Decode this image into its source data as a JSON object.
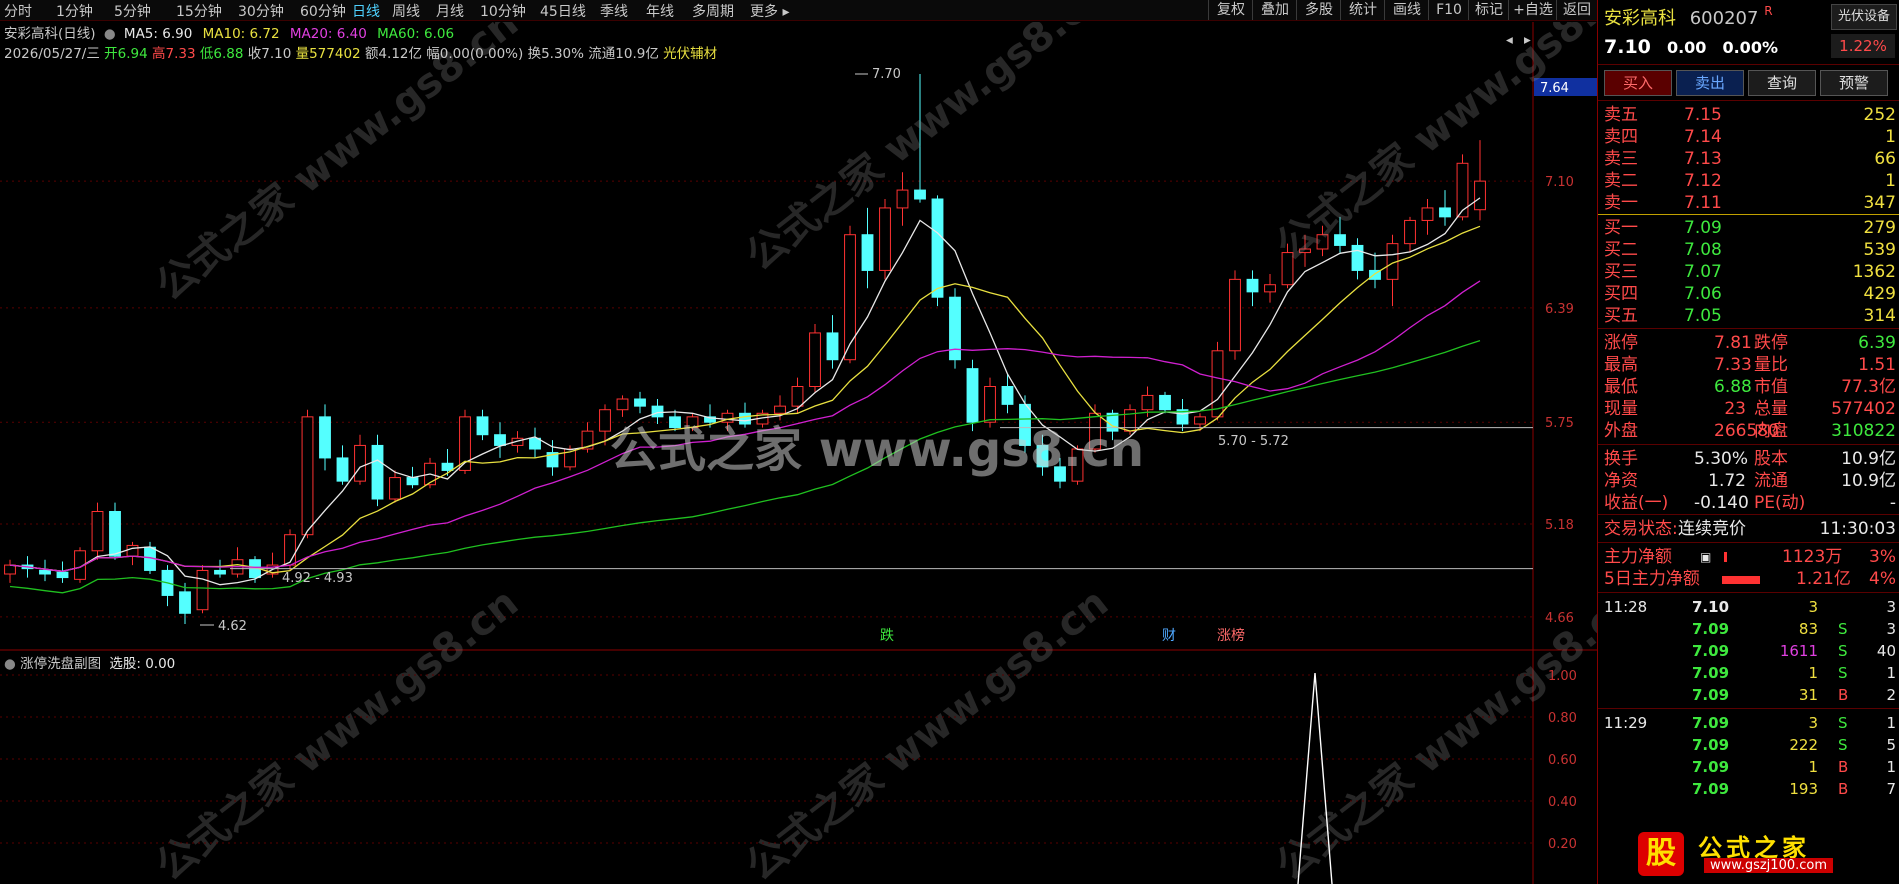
{
  "toolbar": {
    "periods": [
      "分时",
      "1分钟",
      "5分钟",
      "15分钟",
      "30分钟",
      "60分钟",
      "日线",
      "周线",
      "月线",
      "10分钟",
      "45日线",
      "季线",
      "年线",
      "多周期",
      "更多"
    ],
    "active_period_index": 6,
    "tools": [
      "复权",
      "叠加",
      "多股",
      "统计",
      "画线",
      "F10",
      "标记",
      "+自选",
      "返回"
    ]
  },
  "main_chart": {
    "title": "安彩高科(日线)",
    "ma_labels": {
      "ma5": "MA5: 6.90",
      "ma10": "MA10: 6.72",
      "ma20": "MA20: 6.40",
      "ma60": "MA60: 6.06"
    },
    "info_line": {
      "date": "2026/05/27/三",
      "open": "开6.94",
      "high": "高7.33",
      "low": "低6.88",
      "close": "收7.10",
      "volume": "量577402",
      "amount": "额4.12亿",
      "range": "幅0.00(0.00%)",
      "turnover": "换5.30%",
      "float": "流通10.9亿",
      "sector": "光伏辅材"
    },
    "price_ticks": [
      "7.10",
      "6.39",
      "5.75",
      "5.18",
      "4.66"
    ],
    "current_price_tag": "7.64",
    "annotations": {
      "peak": "7.70",
      "low": "4.62",
      "range1": "4.92 - 4.93",
      "range2": "5.70 - 5.72"
    },
    "event_markers": [
      {
        "text": "跌",
        "color": "#3ee83e"
      },
      {
        "text": "财",
        "color": "#4fa8ff"
      },
      {
        "text": "涨榜",
        "color": "#ff6a6a"
      }
    ],
    "watermark_center": "公式之家 www.gs8.cn",
    "watermark_diag": "公式之家 www.gs8.cn"
  },
  "sub_chart": {
    "title": "涨停洗盘副图",
    "value_label": "选股: 0.00",
    "ticks": [
      "1.00",
      "0.80",
      "0.60",
      "0.40",
      "0.20"
    ]
  },
  "chart_data": {
    "type": "candlestick",
    "title": "安彩高科(日线)",
    "candles": [
      [
        4.9,
        4.98,
        4.85,
        4.95
      ],
      [
        4.95,
        5.0,
        4.88,
        4.93
      ],
      [
        4.92,
        4.98,
        4.86,
        4.9
      ],
      [
        4.91,
        4.97,
        4.85,
        4.88
      ],
      [
        4.87,
        5.05,
        4.85,
        5.03
      ],
      [
        5.03,
        5.3,
        4.98,
        5.25
      ],
      [
        5.25,
        5.3,
        4.98,
        5.0
      ],
      [
        5.0,
        5.08,
        4.95,
        5.06
      ],
      [
        5.05,
        5.08,
        4.9,
        4.92
      ],
      [
        4.92,
        4.95,
        4.72,
        4.78
      ],
      [
        4.8,
        4.85,
        4.62,
        4.68
      ],
      [
        4.7,
        4.95,
        4.68,
        4.92
      ],
      [
        4.92,
        4.98,
        4.88,
        4.9
      ],
      [
        4.9,
        5.05,
        4.88,
        4.98
      ],
      [
        4.98,
        5.0,
        4.85,
        4.88
      ],
      [
        4.9,
        5.02,
        4.88,
        4.95
      ],
      [
        4.95,
        5.15,
        4.92,
        5.12
      ],
      [
        5.12,
        5.82,
        5.1,
        5.78
      ],
      [
        5.78,
        5.85,
        5.48,
        5.55
      ],
      [
        5.55,
        5.62,
        5.4,
        5.42
      ],
      [
        5.42,
        5.68,
        5.4,
        5.62
      ],
      [
        5.62,
        5.68,
        5.28,
        5.32
      ],
      [
        5.32,
        5.48,
        5.3,
        5.44
      ],
      [
        5.44,
        5.5,
        5.38,
        5.4
      ],
      [
        5.4,
        5.55,
        5.38,
        5.52
      ],
      [
        5.52,
        5.6,
        5.45,
        5.48
      ],
      [
        5.48,
        5.82,
        5.46,
        5.78
      ],
      [
        5.78,
        5.82,
        5.65,
        5.68
      ],
      [
        5.68,
        5.75,
        5.55,
        5.62
      ],
      [
        5.62,
        5.7,
        5.58,
        5.66
      ],
      [
        5.66,
        5.72,
        5.55,
        5.6
      ],
      [
        5.58,
        5.65,
        5.45,
        5.5
      ],
      [
        5.5,
        5.62,
        5.48,
        5.6
      ],
      [
        5.6,
        5.75,
        5.58,
        5.7
      ],
      [
        5.7,
        5.85,
        5.62,
        5.82
      ],
      [
        5.82,
        5.9,
        5.78,
        5.88
      ],
      [
        5.88,
        5.92,
        5.8,
        5.84
      ],
      [
        5.84,
        5.88,
        5.74,
        5.78
      ],
      [
        5.78,
        5.82,
        5.7,
        5.72
      ],
      [
        5.72,
        5.8,
        5.7,
        5.78
      ],
      [
        5.78,
        5.85,
        5.72,
        5.75
      ],
      [
        5.75,
        5.82,
        5.7,
        5.8
      ],
      [
        5.8,
        5.86,
        5.72,
        5.74
      ],
      [
        5.74,
        5.82,
        5.72,
        5.8
      ],
      [
        5.8,
        5.9,
        5.76,
        5.84
      ],
      [
        5.84,
        6.0,
        5.8,
        5.95
      ],
      [
        5.95,
        6.3,
        5.92,
        6.25
      ],
      [
        6.25,
        6.35,
        6.05,
        6.1
      ],
      [
        6.1,
        6.85,
        6.08,
        6.8
      ],
      [
        6.8,
        6.95,
        6.5,
        6.6
      ],
      [
        6.6,
        7.0,
        6.55,
        6.95
      ],
      [
        6.95,
        7.15,
        6.85,
        7.05
      ],
      [
        7.05,
        7.7,
        6.98,
        7.0
      ],
      [
        7.0,
        7.02,
        6.4,
        6.45
      ],
      [
        6.45,
        6.5,
        6.05,
        6.1
      ],
      [
        6.05,
        6.1,
        5.7,
        5.75
      ],
      [
        5.75,
        6.0,
        5.72,
        5.95
      ],
      [
        5.95,
        6.02,
        5.8,
        5.85
      ],
      [
        5.85,
        5.9,
        5.58,
        5.62
      ],
      [
        5.62,
        5.68,
        5.45,
        5.5
      ],
      [
        5.5,
        5.55,
        5.38,
        5.42
      ],
      [
        5.42,
        5.62,
        5.4,
        5.6
      ],
      [
        5.6,
        5.85,
        5.58,
        5.8
      ],
      [
        5.8,
        5.82,
        5.65,
        5.7
      ],
      [
        5.7,
        5.85,
        5.68,
        5.82
      ],
      [
        5.82,
        5.95,
        5.78,
        5.9
      ],
      [
        5.9,
        5.92,
        5.8,
        5.82
      ],
      [
        5.82,
        5.88,
        5.7,
        5.74
      ],
      [
        5.74,
        5.8,
        5.7,
        5.78
      ],
      [
        5.78,
        6.2,
        5.76,
        6.15
      ],
      [
        6.15,
        6.6,
        6.1,
        6.55
      ],
      [
        6.55,
        6.6,
        6.4,
        6.48
      ],
      [
        6.48,
        6.58,
        6.42,
        6.52
      ],
      [
        6.52,
        6.75,
        6.5,
        6.7
      ],
      [
        6.7,
        6.8,
        6.62,
        6.72
      ],
      [
        6.72,
        6.85,
        6.68,
        6.8
      ],
      [
        6.8,
        6.9,
        6.7,
        6.74
      ],
      [
        6.74,
        6.78,
        6.55,
        6.6
      ],
      [
        6.6,
        6.7,
        6.5,
        6.55
      ],
      [
        6.55,
        6.8,
        6.4,
        6.75
      ],
      [
        6.75,
        6.9,
        6.7,
        6.88
      ],
      [
        6.88,
        7.0,
        6.8,
        6.95
      ],
      [
        6.95,
        7.05,
        6.85,
        6.9
      ],
      [
        6.9,
        7.25,
        6.88,
        7.2
      ],
      [
        6.94,
        7.33,
        6.88,
        7.1
      ]
    ],
    "y_ticks": [
      7.1,
      6.39,
      5.75,
      5.18,
      4.66
    ],
    "ylim": [
      4.5,
      7.8
    ]
  },
  "panel": {
    "stock_name": "安彩高科",
    "stock_code": "600207",
    "r_mark": "R",
    "sector_button": "光伏设备",
    "sector_change": "1.22%",
    "price": "7.10",
    "change": "0.00",
    "change_pct": "0.00%",
    "buttons": [
      "买入",
      "卖出",
      "查询",
      "预警"
    ],
    "asks": [
      {
        "label": "卖五",
        "price": "7.15",
        "vol": "252"
      },
      {
        "label": "卖四",
        "price": "7.14",
        "vol": "1"
      },
      {
        "label": "卖三",
        "price": "7.13",
        "vol": "66"
      },
      {
        "label": "卖二",
        "price": "7.12",
        "vol": "1"
      },
      {
        "label": "卖一",
        "price": "7.11",
        "vol": "347"
      }
    ],
    "bids": [
      {
        "label": "买一",
        "price": "7.09",
        "vol": "279"
      },
      {
        "label": "买二",
        "price": "7.08",
        "vol": "539"
      },
      {
        "label": "买三",
        "price": "7.07",
        "vol": "1362"
      },
      {
        "label": "买四",
        "price": "7.06",
        "vol": "429"
      },
      {
        "label": "买五",
        "price": "7.05",
        "vol": "314"
      }
    ],
    "stats": [
      {
        "l1": "涨停",
        "v1": "7.81",
        "l2": "跌停",
        "v2": "6.39"
      },
      {
        "l1": "最高",
        "v1": "7.33",
        "l2": "量比",
        "v2": "1.51"
      },
      {
        "l1": "最低",
        "v1": "6.88",
        "l2": "市值",
        "v2": "77.3亿"
      },
      {
        "l1": "现量",
        "v1": "23",
        "l2": "总量",
        "v2": "577402"
      },
      {
        "l1": "外盘",
        "v1": "266580",
        "l2": "内盘",
        "v2": "310822"
      }
    ],
    "stats2": [
      {
        "l1": "换手",
        "v1": "5.30%",
        "l2": "股本",
        "v2": "10.9亿"
      },
      {
        "l1": "净资",
        "v1": "1.72",
        "l2": "流通",
        "v2": "10.9亿"
      },
      {
        "l1": "收益(一)",
        "v1": "-0.140",
        "l2": "PE(动)",
        "v2": "-"
      }
    ],
    "trade_status_label": "交易状态:",
    "trade_status": "连续竞价",
    "trade_time": "11:30:03",
    "main_net_label": "主力净额",
    "main_net_value": "1123万",
    "main_net_pct": "3%",
    "main_net5_label": "5日主力净额",
    "main_net5_value": "1.21亿",
    "main_net5_pct": "4%",
    "ticks": [
      {
        "time": "11:28",
        "price": "7.10",
        "vol": "3",
        "bs": "",
        "extra": "3"
      },
      {
        "time": "",
        "price": "7.09",
        "vol": "83",
        "bs": "S",
        "extra": "3"
      },
      {
        "time": "",
        "price": "7.09",
        "vol": "1611",
        "bs": "S",
        "extra": "40"
      },
      {
        "time": "",
        "price": "7.09",
        "vol": "1",
        "bs": "S",
        "extra": "1"
      },
      {
        "time": "",
        "price": "7.09",
        "vol": "31",
        "bs": "B",
        "extra": "2"
      },
      {
        "time": "11:29",
        "price": "7.09",
        "vol": "3",
        "bs": "S",
        "extra": "1"
      },
      {
        "time": "",
        "price": "7.09",
        "vol": "222",
        "bs": "S",
        "extra": "5"
      },
      {
        "time": "",
        "price": "7.09",
        "vol": "1",
        "bs": "B",
        "extra": "1"
      },
      {
        "time": "",
        "price": "7.09",
        "vol": "193",
        "bs": "B",
        "extra": "7"
      }
    ],
    "logo_text": "公式之家",
    "logo_url": "www.gszj100.com",
    "logo_badge": "股"
  },
  "colors": {
    "up": "#ff3232",
    "down": "#54ffff",
    "ma5": "#e8e8e8",
    "ma10": "#e8e040",
    "ma20": "#d020d0",
    "ma60": "#20c020",
    "axis": "#8b0000"
  }
}
